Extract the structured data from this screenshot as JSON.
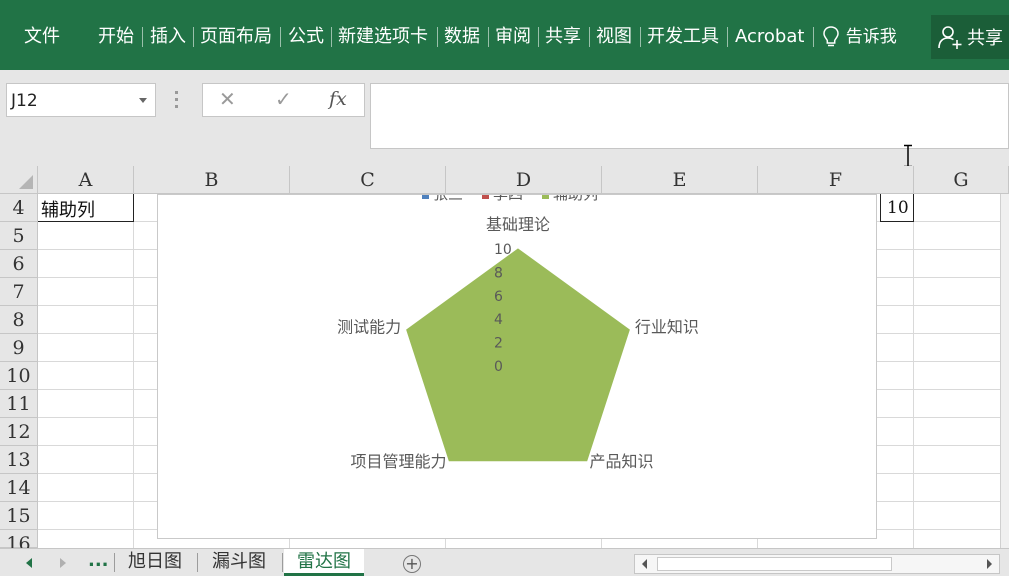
{
  "ribbon": {
    "tabs": [
      "文件",
      "开始",
      "插入",
      "页面布局",
      "公式",
      "新建选项卡",
      "数据",
      "审阅",
      "共享",
      "视图",
      "开发工具",
      "Acrobat"
    ],
    "tell_me": "告诉我",
    "share": "共享"
  },
  "formula_bar": {
    "name_box": "J12",
    "fx_label": "fx",
    "formula": ""
  },
  "columns": [
    "A",
    "B",
    "C",
    "D",
    "E",
    "F",
    "G"
  ],
  "rows": [
    "4",
    "5",
    "6",
    "7",
    "8",
    "9",
    "10",
    "11",
    "12",
    "13",
    "14",
    "15",
    "16"
  ],
  "cells": {
    "A4": "辅助列",
    "F4": "10"
  },
  "chart_data": {
    "type": "radar",
    "categories": [
      "基础理论",
      "行业知识",
      "产品知识",
      "项目管理能力",
      "测试能力"
    ],
    "radial_ticks": [
      "0",
      "2",
      "4",
      "6",
      "8",
      "10"
    ],
    "rlim": [
      0,
      10
    ],
    "legend": [
      "张三",
      "李四",
      "辅助列"
    ],
    "legend_placement": "top",
    "series": [
      {
        "name": "辅助列",
        "values": [
          10,
          10,
          10,
          10,
          10
        ],
        "color": "#9bbb59",
        "fill": true
      }
    ]
  },
  "sheets": {
    "ellipsis": "...",
    "tabs": [
      "旭日图",
      "漏斗图",
      "雷达图"
    ],
    "active": "雷达图",
    "add_label": "+"
  },
  "colors": {
    "ribbon": "#217346",
    "accent": "#217346",
    "radar_fill": "#9bbb59"
  }
}
